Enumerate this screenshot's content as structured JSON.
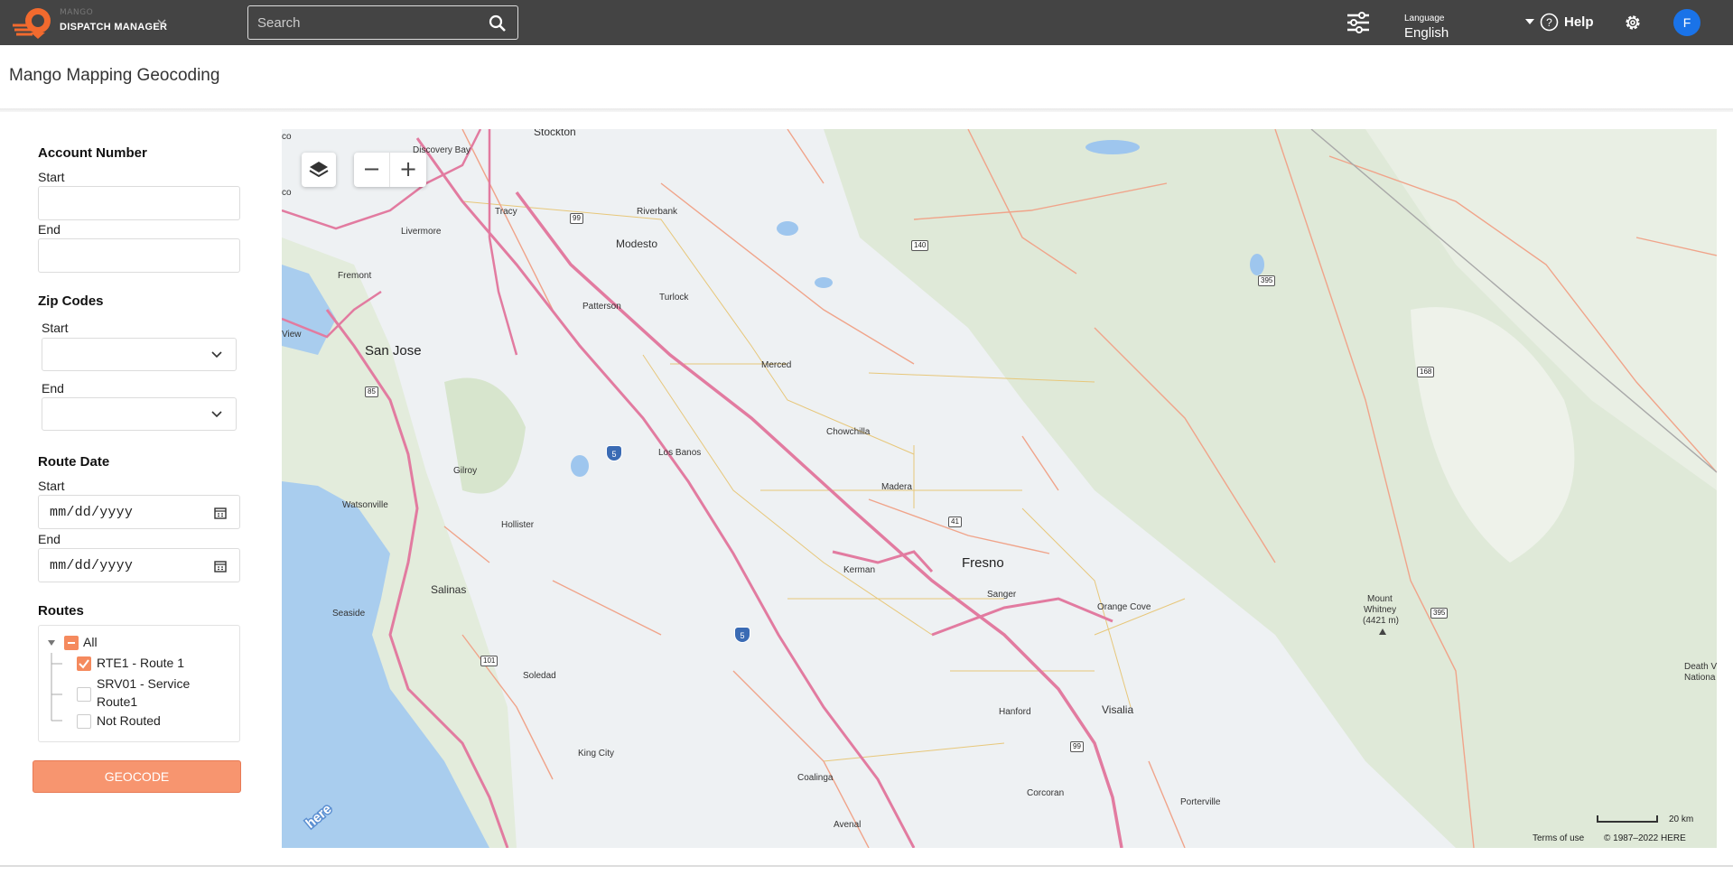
{
  "header": {
    "brand_small": "MANGO",
    "brand_name": "DISPATCH MANAGER",
    "search_placeholder": "Search",
    "language_label": "Language",
    "language_value": "English",
    "help_label": "Help",
    "avatar_initial": "F",
    "icons": [
      "mango-logo-icon",
      "chevron-down-icon",
      "search-icon",
      "sliders-icon",
      "caret-down-icon",
      "help-icon",
      "gear-icon"
    ]
  },
  "page": {
    "title": "Mango Mapping Geocoding"
  },
  "filters": {
    "account_number": {
      "title": "Account Number",
      "start_label": "Start",
      "end_label": "End",
      "start_value": "",
      "end_value": ""
    },
    "zip_codes": {
      "title": "Zip Codes",
      "start_label": "Start",
      "end_label": "End",
      "start_value": "",
      "end_value": ""
    },
    "route_date": {
      "title": "Route Date",
      "start_label": "Start",
      "end_label": "End",
      "start_value": "mm/dd/yyyy",
      "end_value": "mm/dd/yyyy"
    },
    "routes": {
      "title": "Routes",
      "root": {
        "label": "All",
        "state": "indeterminate"
      },
      "items": [
        {
          "label": "RTE1 - Route 1",
          "checked": true
        },
        {
          "label_line1": "SRV01 - Service",
          "label_line2": "Route1",
          "checked": false
        },
        {
          "label": "Not Routed",
          "checked": false
        }
      ]
    },
    "geocode_button": "GEOCODE",
    "accent_color": "#f7956f"
  },
  "map": {
    "zoom_out": "−",
    "zoom_in": "+",
    "cities": {
      "stockton": "Stockton",
      "discovery_bay": "Discovery Bay",
      "tracy": "Tracy",
      "riverbank": "Riverbank",
      "livermore": "Livermore",
      "modesto": "Modesto",
      "fremont": "Fremont",
      "patterson": "Patterson",
      "turlock": "Turlock",
      "san_jose": "San Jose",
      "merced": "Merced",
      "chowchilla": "Chowchilla",
      "los_banos": "Los Banos",
      "gilroy": "Gilroy",
      "madera": "Madera",
      "watsonville": "Watsonville",
      "hollister": "Hollister",
      "fresno": "Fresno",
      "kerman": "Kerman",
      "sanger": "Sanger",
      "orange_cove": "Orange Cove",
      "salinas": "Salinas",
      "seaside": "Seaside",
      "soledad": "Soledad",
      "hanford": "Hanford",
      "visalia": "Visalia",
      "king_city": "King City",
      "coalinga": "Coalinga",
      "corcoran": "Corcoran",
      "porterville": "Porterville",
      "avenal": "Avenal",
      "view": "View",
      "co": "co",
      "death_valley": "Death V",
      "death_valley_2": "Nationa",
      "mount_whitney_1": "Mount",
      "mount_whitney_2": "Whitney",
      "mount_whitney_3": "(4421 m)"
    },
    "shields": {
      "r99a": "99",
      "r140": "140",
      "r395a": "395",
      "r168": "168",
      "r85": "85",
      "r41": "41",
      "r101": "101",
      "r99b": "99",
      "r395b": "395",
      "i5a": "5",
      "i5b": "5"
    },
    "scale_label": "20 km",
    "terms": "Terms of use",
    "copyright": "© 1987–2022 HERE",
    "here_logo": "here"
  }
}
